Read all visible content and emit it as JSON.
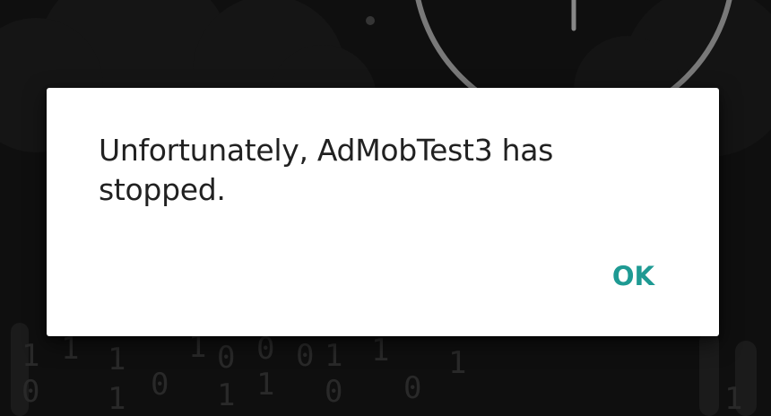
{
  "dialog": {
    "message": "Unfortunately, AdMobTest3 has stopped.",
    "ok_label": "OK"
  },
  "wallpaper": {
    "digits": [
      "1",
      "0",
      "1",
      "1",
      "1",
      "0",
      "1",
      "0",
      "1",
      "0",
      "1",
      "0",
      "1",
      "0",
      "1",
      "0",
      "1",
      "1"
    ]
  },
  "colors": {
    "accent": "#1e9a93",
    "dialog_background": "#ffffff",
    "message_text": "#212121",
    "screen_background": "#151515"
  }
}
